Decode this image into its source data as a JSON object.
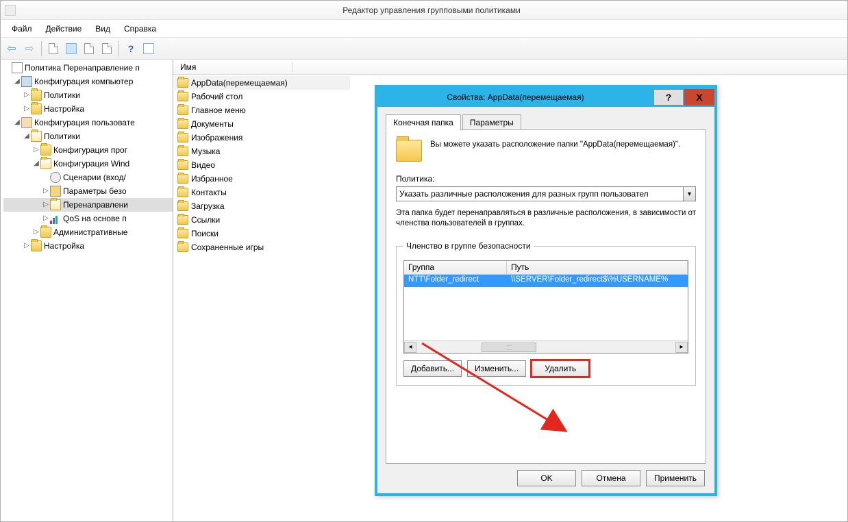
{
  "window": {
    "title": "Редактор управления групповыми политиками"
  },
  "menu": {
    "file": "Файл",
    "action": "Действие",
    "view": "Вид",
    "help": "Справка"
  },
  "tree": {
    "root": "Политика Перенаправление п",
    "compCfg": "Конфигурация компьютер",
    "policies": "Политики",
    "settings": "Настройка",
    "userCfg": "Конфигурация пользовате",
    "confProg": "Конфигурация прог",
    "confWin": "Конфигурация Wind",
    "scenarios": "Сценарии (вход/",
    "secParams": "Параметры безо",
    "redirect": "Перенаправлени",
    "qos": "QoS на основе п",
    "admTpl": "Административные"
  },
  "list": {
    "headerName": "Имя",
    "items": [
      "AppData(перемещаемая)",
      "Рабочий стол",
      "Главное меню",
      "Документы",
      "Изображения",
      "Музыка",
      "Видео",
      "Избранное",
      "Контакты",
      "Загрузка",
      "Ссылки",
      "Поиски",
      "Сохраненные игры"
    ]
  },
  "dialog": {
    "title": "Свойства: AppData(перемещаемая)",
    "tabTarget": "Конечная папка",
    "tabParams": "Параметры",
    "hint": "Вы можете указать расположение папки \"AppData(перемещаемая)\".",
    "policyLabel": "Политика:",
    "policyValue": "Указать различные расположения для разных групп пользовател",
    "desc": "Эта папка будет перенаправляться в различные расположения, в зависимости от членства пользователей в группах.",
    "groupLegend": "Членство в группе безопасности",
    "colGroup": "Группа",
    "colPath": "Путь",
    "rowGroup": "NTT\\Folder_redirect",
    "rowPath": "\\\\SERVER\\Folder_redirect$\\%USERNAME%",
    "btnAdd": "Добавить...",
    "btnEdit": "Изменить...",
    "btnDel": "Удалить",
    "btnOK": "OK",
    "btnCancel": "Отмена",
    "btnApply": "Применить"
  }
}
